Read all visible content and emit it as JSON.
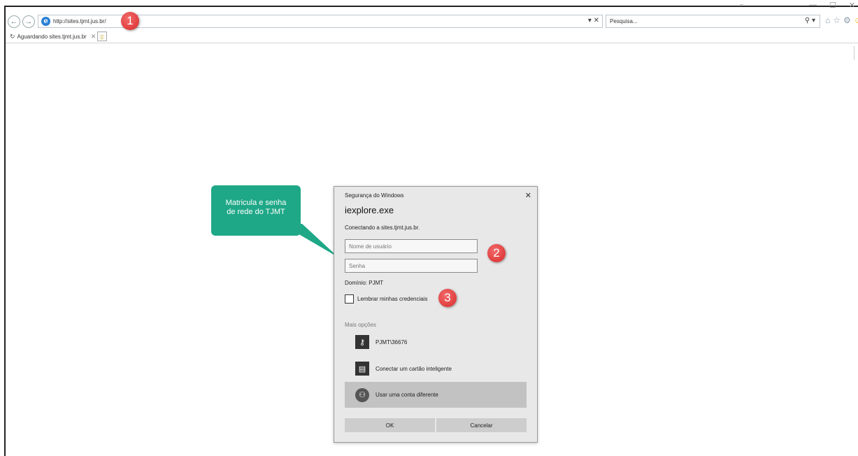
{
  "browser": {
    "url": "http://sites.tjmt.jus.br/",
    "search_placeholder": "Pesquisa...",
    "tab_title": "Aguardando sites.tjmt.jus.br",
    "icons": [
      "back-icon",
      "forward-icon",
      "ie-logo-icon",
      "home-icon",
      "star-icon",
      "gear-icon",
      "smiley-icon"
    ]
  },
  "callout": {
    "text_line1": "Matricula e senha",
    "text_line2": "de rede do TJMT",
    "color": "#1fa887"
  },
  "badges": {
    "one": "1",
    "two": "2",
    "three": "3",
    "color": "#d92b2b"
  },
  "dialog": {
    "caption": "Segurança do Windows",
    "app_name": "iexplore.exe",
    "connecting": "Conectando a sites.tjmt.jus.br.",
    "username_placeholder": "Nome de usuário",
    "password_placeholder": "Senha",
    "domain": "Domínio: PJMT",
    "remember_label": "Lembrar minhas credenciais",
    "more_options": "Mais opções",
    "options": [
      {
        "label": "PJMT\\36676",
        "icon": "key-icon"
      },
      {
        "label": "Conectar um cartão inteligente",
        "icon": "smartcard-icon"
      },
      {
        "label": "Usar uma conta diferente",
        "icon": "user-icon"
      }
    ],
    "ok_label": "OK",
    "cancel_label": "Cancelar"
  }
}
